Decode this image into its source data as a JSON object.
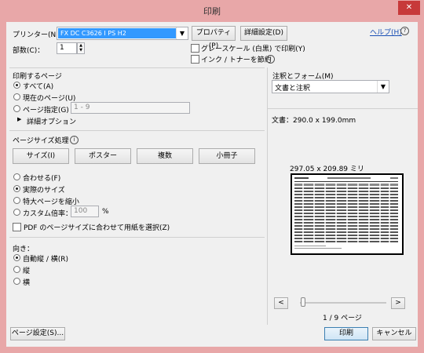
{
  "window": {
    "title": "印刷",
    "close": "✕"
  },
  "printer": {
    "label": "プリンター(N)：",
    "value": "FX DC C3626 I PS H2",
    "properties": "プロパティ(P)",
    "advanced": "詳細設定(D)"
  },
  "copies": {
    "label": "部数(C)：",
    "value": "1"
  },
  "options": {
    "grayscale": "グレースケール (白黒) で印刷(Y)",
    "save_ink": "インク / トナーを節約"
  },
  "help": {
    "label": "ヘルプ(H)"
  },
  "pages": {
    "heading": "印刷するページ",
    "all": "すべて(A)",
    "current": "現在のページ(U)",
    "range": "ページ指定(G)",
    "range_placeholder": "1 - 9",
    "more": "詳細オプション"
  },
  "sizing": {
    "heading": "ページサイズ処理",
    "tabs": [
      "サイズ(I)",
      "ポスター",
      "複数",
      "小冊子"
    ],
    "fit": "合わせる(F)",
    "actual": "実際のサイズ",
    "shrink": "特大ページを縮小",
    "custom": "カスタム倍率：",
    "custom_value": "100",
    "custom_unit": "%",
    "pdf_paper": "PDF のページサイズに合わせて用紙を選択(Z)"
  },
  "orientation": {
    "heading": "向き：",
    "auto": "自動縦 / 横(R)",
    "portrait": "縦",
    "landscape": "横"
  },
  "comments": {
    "heading": "注釈とフォーム(M)",
    "value": "文書と注釈"
  },
  "preview": {
    "doc_size": "文書：290.0 x 199.0mm",
    "paper_size": "297.05 x 209.89 ミリ",
    "page_counter": "1 / 9 ページ",
    "prev": "<",
    "next": ">"
  },
  "footer": {
    "page_setup": "ページ設定(S)...",
    "print": "印刷",
    "cancel": "キャンセル"
  }
}
